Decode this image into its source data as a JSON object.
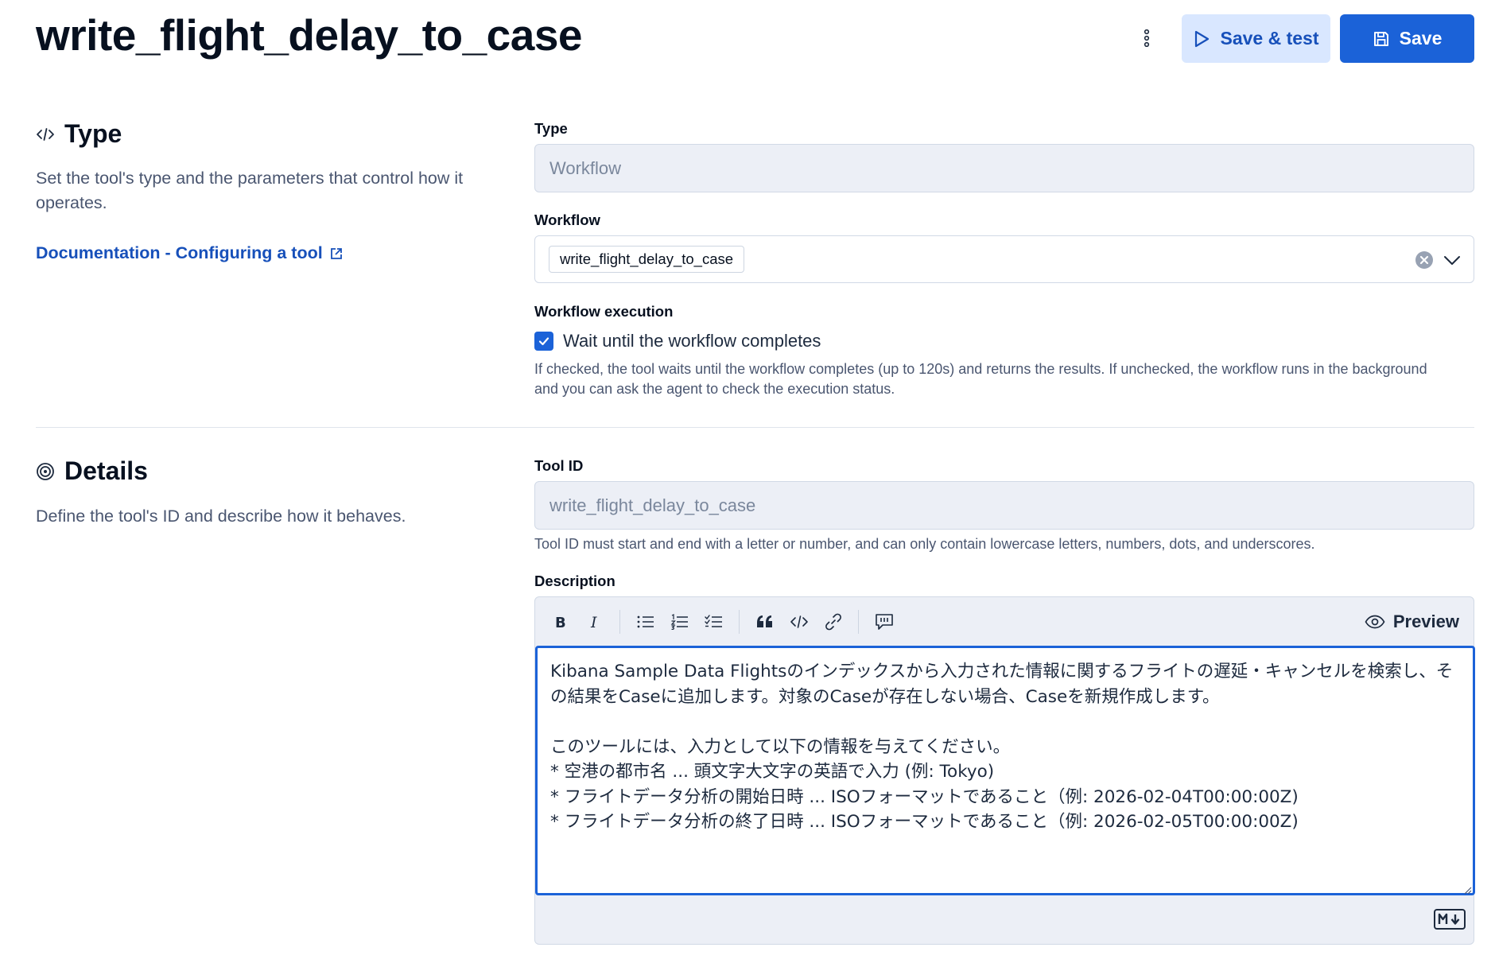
{
  "header": {
    "title": "write_flight_delay_to_case",
    "save_test_label": "Save & test",
    "save_label": "Save"
  },
  "type_section": {
    "title": "Type",
    "description": "Set the tool's type and the parameters that control how it operates.",
    "doc_link": "Documentation - Configuring a tool",
    "type_label": "Type",
    "type_value": "Workflow",
    "workflow_label": "Workflow",
    "workflow_value": "write_flight_delay_to_case",
    "execution_label": "Workflow execution",
    "wait_checkbox_label": "Wait until the workflow completes",
    "wait_checked": true,
    "execution_help": "If checked, the tool waits until the workflow completes (up to 120s) and returns the results. If unchecked, the workflow runs in the background and you can ask the agent to check the execution status."
  },
  "details_section": {
    "title": "Details",
    "description": "Define the tool's ID and describe how it behaves.",
    "tool_id_label": "Tool ID",
    "tool_id_value": "write_flight_delay_to_case",
    "tool_id_help": "Tool ID must start and end with a letter or number, and can only contain lowercase letters, numbers, dots, and underscores.",
    "description_label": "Description",
    "preview_label": "Preview",
    "description_value": "Kibana Sample Data Flightsのインデックスから入力された情報に関するフライトの遅延・キャンセルを検索し、その結果をCaseに追加します。対象のCaseが存在しない場合、Caseを新規作成します。\n\nこのツールには、入力として以下の情報を与えてください。\n* 空港の都市名 ... 頭文字大文字の英語で入力 (例: Tokyo)\n* フライトデータ分析の開始日時 ... ISOフォーマットであること（例: 2026-02-04T00:00:00Z)\n* フライトデータ分析の終了日時 ... ISOフォーマットであること（例: 2026-02-05T00:00:00Z)",
    "toolbar_icons": [
      "bold-icon",
      "italic-icon",
      "bullet-list-icon",
      "numbered-list-icon",
      "task-list-icon",
      "quote-icon",
      "code-icon",
      "link-icon",
      "comment-icon"
    ]
  },
  "colors": {
    "primary": "#1b62d8",
    "link": "#1750ba",
    "secondary_bg": "#d9e7ff",
    "input_bg": "#eceff6"
  }
}
